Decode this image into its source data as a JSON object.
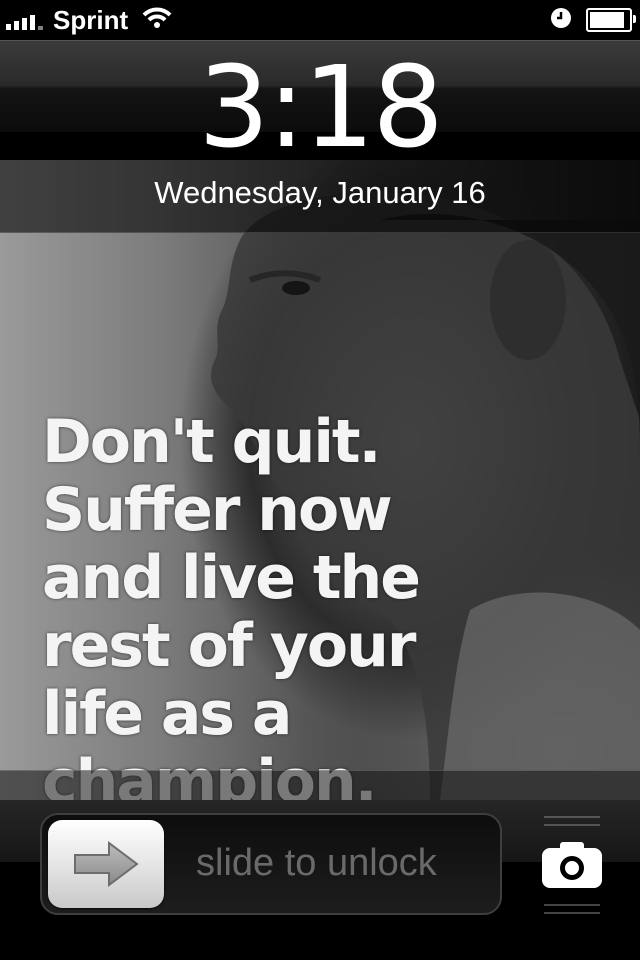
{
  "status_bar": {
    "carrier": "Sprint",
    "signal_bars": 4,
    "icons": [
      "signal-bars-icon",
      "wifi-icon",
      "alarm-clock-icon",
      "battery-icon"
    ],
    "battery_level": 0.9
  },
  "lock_screen": {
    "time": "3:18",
    "date": "Wednesday, January 16"
  },
  "wallpaper": {
    "quote": "Don't quit.\nSuffer now\nand live the\nrest of your\nlife as a\nchampion."
  },
  "unlock": {
    "label": "slide to unlock",
    "knob_icon": "arrow-right-icon",
    "camera_icon": "camera-icon"
  },
  "colors": {
    "background": "#000000",
    "text": "#ffffff",
    "unlock_label": "#6a6a6a"
  }
}
